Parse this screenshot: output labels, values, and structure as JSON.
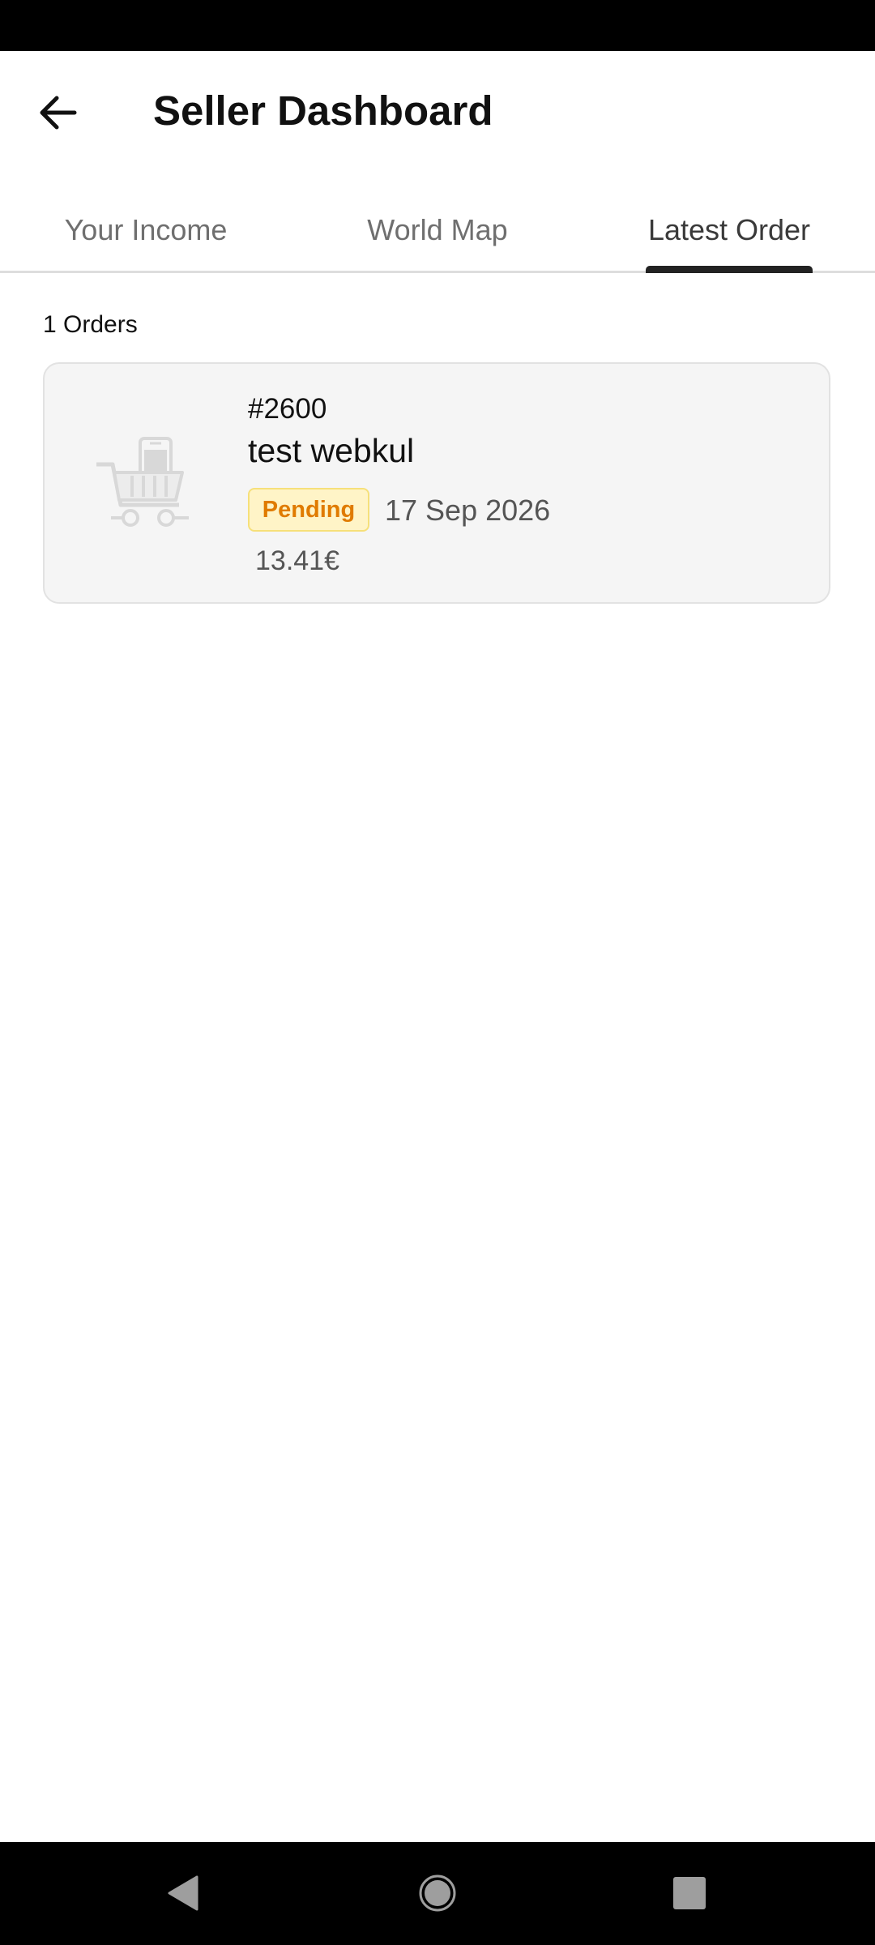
{
  "header": {
    "title": "Seller Dashboard"
  },
  "tabs": [
    {
      "label": "Your Income",
      "active": false
    },
    {
      "label": "World Map",
      "active": false
    },
    {
      "label": "Latest Order",
      "active": true
    }
  ],
  "orders": {
    "count_label": "1 Orders",
    "items": [
      {
        "number": "#2600",
        "customer": "test webkul",
        "status": "Pending",
        "date": "17 Sep 2026",
        "amount": "13.41€",
        "icon": "shopping-cart-icon"
      }
    ]
  },
  "colors": {
    "status_pending_bg": "#fff4c7",
    "status_pending_text": "#e07b00",
    "tab_indicator": "#222222",
    "card_bg": "#f5f5f5"
  },
  "icons": {
    "back": "arrow-left-icon",
    "nav_back": "triangle-back-icon",
    "nav_home": "circle-home-icon",
    "nav_recents": "square-recents-icon"
  }
}
